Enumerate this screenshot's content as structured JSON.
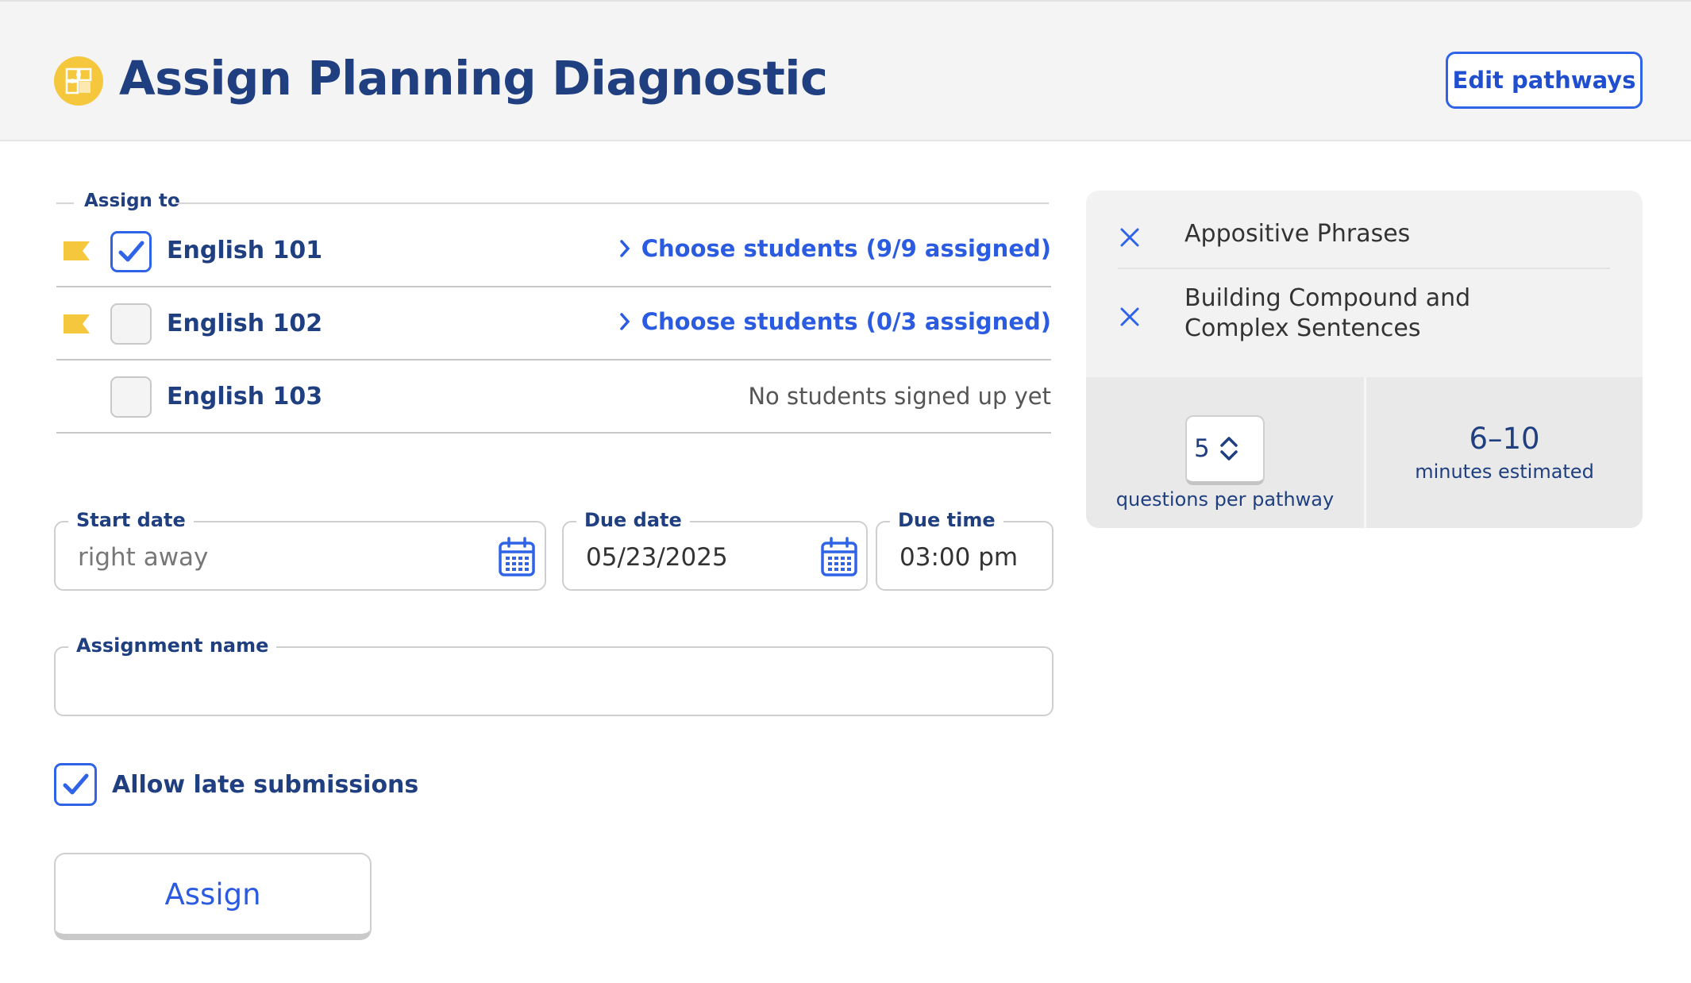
{
  "header": {
    "title": "Assign Planning Diagnostic",
    "logo_icon": "puzzle-icon",
    "edit_button_label": "Edit pathways"
  },
  "assign_to": {
    "legend": "Assign to",
    "classes": [
      {
        "name": "English 101",
        "checked": true,
        "flagged": true,
        "link_label": "Choose students (9/9 assigned)"
      },
      {
        "name": "English 102",
        "checked": false,
        "flagged": true,
        "link_label": "Choose students (0/3 assigned)"
      },
      {
        "name": "English 103",
        "checked": false,
        "flagged": false,
        "status": "No students signed up yet"
      }
    ]
  },
  "fields": {
    "start_date": {
      "label": "Start date",
      "placeholder": "right away"
    },
    "due_date": {
      "label": "Due date",
      "value": "05/23/2025"
    },
    "due_time": {
      "label": "Due time",
      "value": "03:00 pm"
    },
    "assignment_name": {
      "label": "Assignment name",
      "value": ""
    }
  },
  "late_submissions": {
    "label": "Allow late submissions",
    "checked": true
  },
  "assign_button_label": "Assign",
  "pathways_panel": {
    "pathways": [
      "Appositive Phrases",
      "Building Compound and Complex Sentences"
    ],
    "questions_per_pathway": {
      "value": "5",
      "label": "questions per pathway"
    },
    "estimate": {
      "value": "6–10",
      "label": "minutes estimated"
    }
  },
  "colors": {
    "brand_navy": "#1f3f80",
    "accent_blue": "#2f63e8",
    "flag_yellow": "#f5c73d"
  }
}
